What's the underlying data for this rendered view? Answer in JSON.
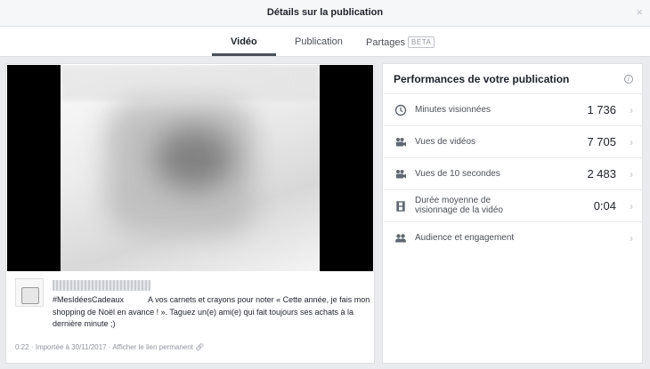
{
  "dialog": {
    "title": "Détails sur la publication",
    "close": "×"
  },
  "tabs": [
    {
      "label": "Vidéo",
      "active": true
    },
    {
      "label": "Publication",
      "active": false
    },
    {
      "label": "Partages",
      "badge": "BETA",
      "active": false
    }
  ],
  "post": {
    "text": "#MesIdéesCadeaux           A vos carnets et crayons pour noter « Cette année, je fais mon shopping de Noël en avance ! ». Taguez un(e) ami(e) qui fait toujours ses achats à la dernière minute ;)",
    "duration": "0:22",
    "separator": "·",
    "imported": "Importée à 30/11/2017",
    "permalink": "Afficher le lien permanent"
  },
  "performance": {
    "title": "Performances de votre publication",
    "info_icon": "info-icon",
    "metrics": [
      {
        "icon": "clock-icon",
        "label": "Minutes visionnées",
        "value": "1 736"
      },
      {
        "icon": "video-camera-icon",
        "label": "Vues de vidéos",
        "value": "7 705"
      },
      {
        "icon": "video-camera-icon",
        "label": "Vues de 10 secondes",
        "value": "2 483"
      },
      {
        "icon": "film-icon",
        "label": "Durée moyenne de visionnage de la vidéo",
        "value": "0:04"
      },
      {
        "icon": "people-icon",
        "label": "Audience et engagement",
        "value": ""
      }
    ]
  },
  "colors": {
    "accent": "#4b4f56",
    "border": "#dddfe2",
    "background": "#e9ebee"
  }
}
